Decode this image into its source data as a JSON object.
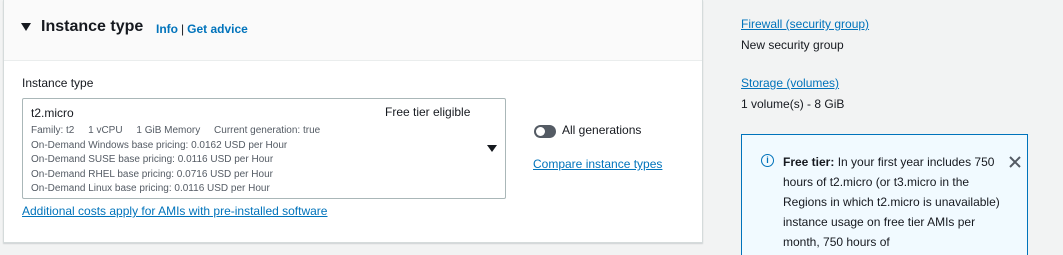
{
  "section": {
    "title": "Instance type",
    "info_link": "Info",
    "advice_link": "Get advice",
    "separator": "|"
  },
  "instance_select": {
    "field_label": "Instance type",
    "selected": "t2.micro",
    "tag": "Free tier eligible",
    "family": "Family: t2",
    "vcpu": "1 vCPU",
    "memory": "1 GiB Memory",
    "generation": "Current generation: true",
    "pricing": [
      "On-Demand Windows base pricing: 0.0162 USD per Hour",
      "On-Demand SUSE base pricing: 0.0116 USD per Hour",
      "On-Demand RHEL base pricing: 0.0716 USD per Hour",
      "On-Demand Linux base pricing: 0.0116 USD per Hour"
    ],
    "footnote": "Additional costs apply for AMIs with pre-installed software"
  },
  "toggle": {
    "label": "All generations",
    "state": "off"
  },
  "compare_link": "Compare instance types",
  "summary": {
    "firewall_label": "Firewall (security group)",
    "firewall_value": "New security group",
    "storage_label": "Storage (volumes)",
    "storage_value": "1 volume(s) - 8 GiB"
  },
  "free_tier": {
    "heading": "Free tier:",
    "body": "In your first year includes 750 hours of t2.micro (or t3.micro in the Regions in which t2.micro is unavailable) instance usage on free tier AMIs per month, 750 hours of"
  },
  "colors": {
    "link": "#0073bb",
    "info_bg": "#f1faff",
    "toggle_off": "#545b64"
  }
}
